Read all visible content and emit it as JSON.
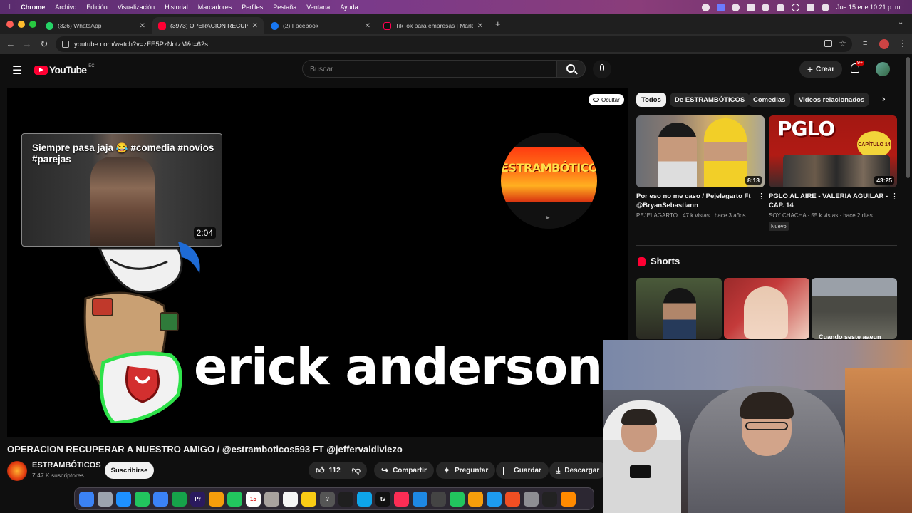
{
  "menubar": {
    "app": "Chrome",
    "items": [
      "Archivo",
      "Edición",
      "Visualización",
      "Historial",
      "Marcadores",
      "Perfiles",
      "Pestaña",
      "Ventana",
      "Ayuda"
    ],
    "clock": "Jue 15 ene 10:21 p. m."
  },
  "tabs": [
    {
      "title": "(326) WhatsApp",
      "favicon_color": "#25d366"
    },
    {
      "title": "(3973) OPERACION RECUPERA",
      "favicon_color": "#ff0033"
    },
    {
      "title": "(2) Facebook",
      "favicon_color": "#1877f2"
    },
    {
      "title": "TikTok para empresas | Marke",
      "favicon_color": "#ff0050"
    }
  ],
  "address": {
    "url": "youtube.com/watch?v=zFE5PzNotzM&t=62s"
  },
  "youtube": {
    "logo_text": "YouTube",
    "region": "EC",
    "search_placeholder": "Buscar",
    "create_label": "Crear",
    "notif_count": "9+"
  },
  "player": {
    "hide_label": "Ocultar",
    "endcard_title": "Siempre pasa jaja 😂 #comedia #novios #parejas",
    "endcard_duration": "2:04",
    "channel_logo_text": "ESTRAMBÓTICOS",
    "big_text": "erick anderson"
  },
  "video": {
    "title": "OPERACION RECUPERAR A NUESTRO AMIGO / @estramboticos593 FT @jeffervaldiviezo",
    "channel": "ESTRAMBÓTICOS",
    "subscribers": "7.47 K suscriptores",
    "subscribe_label": "Suscribirse",
    "likes": "112",
    "share_label": "Compartir",
    "ask_label": "Preguntar",
    "save_label": "Guardar",
    "download_label": "Descargar"
  },
  "chips": [
    "Todos",
    "De ESTRAMBÓTICOS",
    "Comedias",
    "Videos relacionados"
  ],
  "recommendations": [
    {
      "title": "Por eso no me caso / Pejelagarto Ft @BryanSebastiann",
      "channel": "PEJELAGARTO",
      "meta": "47 k vistas · hace 3 años",
      "duration": "8:13"
    },
    {
      "title": "PGLO AL AIRE - VALERIA AGUILAR - CAP. 14",
      "channel": "SOY CHACHA",
      "meta": "55 k vistas · hace 2 días",
      "duration": "43:25",
      "badge": "Nuevo",
      "thumb_text": "PGLO",
      "thumb_sub": "CAPÍTULO 14"
    }
  ],
  "shorts": {
    "heading": "Shorts",
    "caption": "Cuando seste aaeun"
  },
  "dock": {
    "apps": [
      {
        "name": "Finder",
        "color": "#3b82f6"
      },
      {
        "name": "Launchpad",
        "color": "#9ca3af"
      },
      {
        "name": "Safari",
        "color": "#1e90ff"
      },
      {
        "name": "Messages",
        "color": "#22c55e"
      },
      {
        "name": "Mail",
        "color": "#3b82f6"
      },
      {
        "name": "Maps",
        "color": "#16a34a"
      },
      {
        "name": "Premiere",
        "color": "#2a1a5e",
        "label": "Pr"
      },
      {
        "name": "Photos",
        "color": "#f59e0b"
      },
      {
        "name": "FaceTime",
        "color": "#22c55e"
      },
      {
        "name": "Calendar",
        "color": "#ffffff",
        "label": "15"
      },
      {
        "name": "Contacts",
        "color": "#a8a29e"
      },
      {
        "name": "Reminders",
        "color": "#f5f5f5"
      },
      {
        "name": "Notes",
        "color": "#facc15"
      },
      {
        "name": "Tips",
        "color": "#555555",
        "label": "?"
      },
      {
        "name": "ChatGPT",
        "color": "#1f1f1f"
      },
      {
        "name": "Freeform",
        "color": "#0ea5e9"
      },
      {
        "name": "TV",
        "color": "#111111",
        "label": "tv"
      },
      {
        "name": "Music",
        "color": "#fb2d55"
      },
      {
        "name": "Keynote",
        "color": "#1e88e5"
      },
      {
        "name": "Screenshot",
        "color": "#444444"
      },
      {
        "name": "Numbers",
        "color": "#22c55e"
      },
      {
        "name": "Pages",
        "color": "#f59e0b"
      },
      {
        "name": "App Store",
        "color": "#1d9bf0"
      },
      {
        "name": "Brave",
        "color": "#f04f23"
      },
      {
        "name": "Settings",
        "color": "#8e8e93"
      },
      {
        "name": "Terminal",
        "color": "#222222"
      },
      {
        "name": "Sublime",
        "color": "#ff8a00"
      }
    ]
  }
}
